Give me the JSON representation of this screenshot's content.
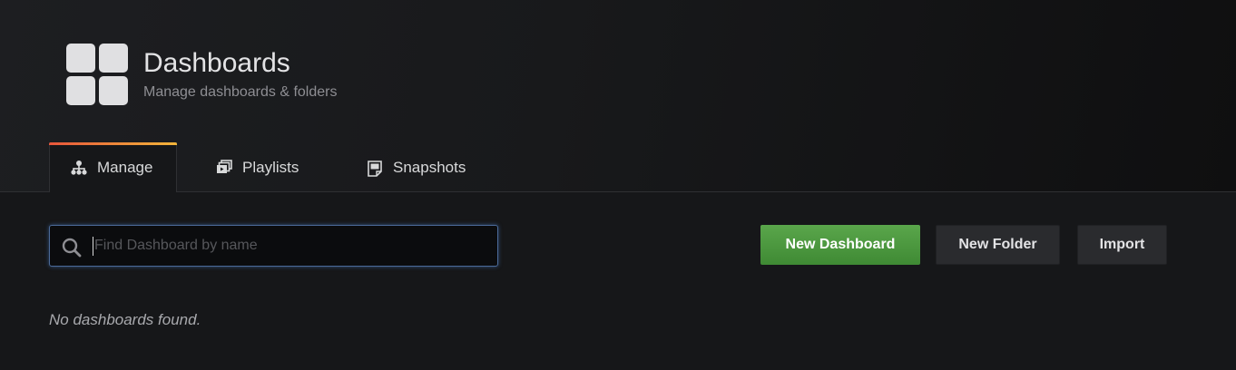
{
  "header": {
    "title": "Dashboards",
    "subtitle": "Manage dashboards & folders",
    "icon": "apps-grid-icon"
  },
  "tabs": [
    {
      "label": "Manage",
      "icon": "sitemap-icon",
      "active": true
    },
    {
      "label": "Playlists",
      "icon": "playlist-icon",
      "active": false
    },
    {
      "label": "Snapshots",
      "icon": "snapshot-icon",
      "active": false
    }
  ],
  "search": {
    "placeholder": "Find Dashboard by name",
    "value": "",
    "icon": "search-icon"
  },
  "actions": {
    "new_dashboard": "New Dashboard",
    "new_folder": "New Folder",
    "import": "Import"
  },
  "empty_state": "No dashboards found.",
  "colors": {
    "background": "#161719",
    "primary_button": "#4f9a42",
    "tab_accent_start": "#e8563b",
    "tab_accent_end": "#f2b53a",
    "focus_border": "#4b6a98"
  }
}
